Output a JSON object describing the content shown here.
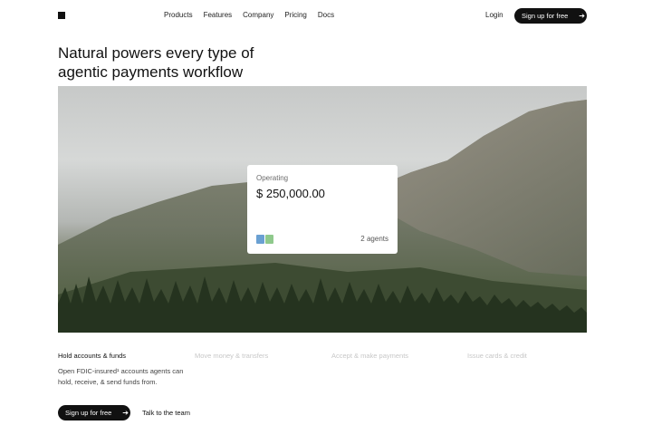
{
  "nav": {
    "items": [
      "Products",
      "Features",
      "Company",
      "Pricing",
      "Docs"
    ],
    "login": "Login",
    "signup": "Sign up for free"
  },
  "hero": {
    "headline": "Natural powers every type of agentic payments workflow",
    "card": {
      "label": "Operating",
      "amount": "$ 250,000.00",
      "agents": "2 agents"
    }
  },
  "features": {
    "tabs": [
      "Hold accounts & funds",
      "Move money & transfers",
      "Accept & make payments",
      "Issue cards & credit"
    ],
    "active_index": 0,
    "description": "Open FDIC-insured¹ accounts agents can hold, receive, & send funds from."
  },
  "actions": {
    "signup": "Sign up for free",
    "talk": "Talk to the team"
  },
  "icons": [
    "logo-square-icon",
    "arrow-right-icon"
  ]
}
